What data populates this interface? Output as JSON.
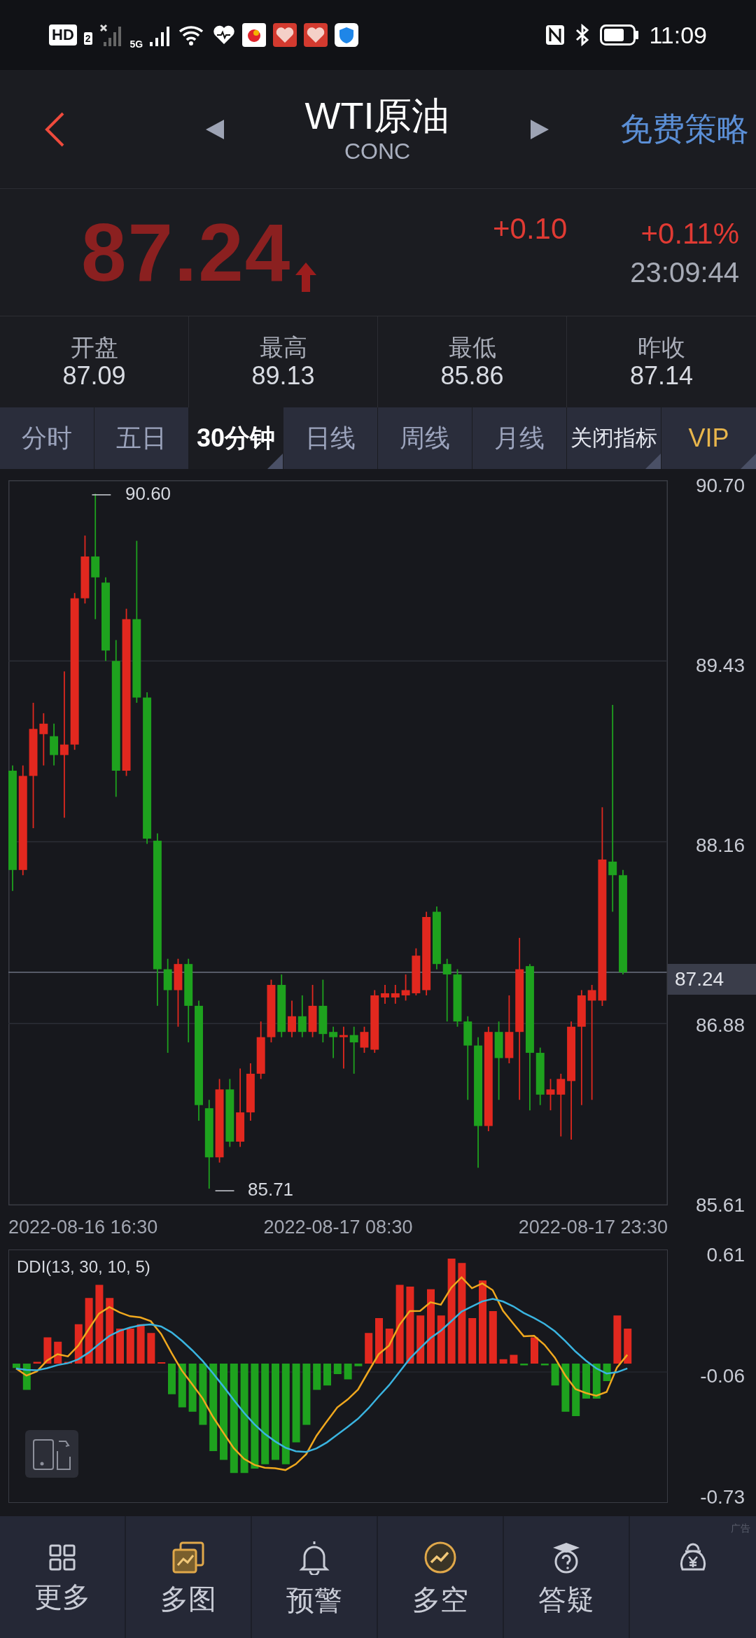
{
  "status_bar": {
    "hd_badge": "HD",
    "sim_number": "2",
    "network": "5G",
    "time": "11:09"
  },
  "header": {
    "title": "WTI原油",
    "subtitle": "CONC",
    "strategy_link": "免费策略"
  },
  "quote": {
    "price": "87.24",
    "rising": true,
    "change": "+0.10",
    "change_percent": "+0.11%",
    "time": "23:09:44"
  },
  "stats": [
    {
      "label": "开盘",
      "value": "87.09"
    },
    {
      "label": "最高",
      "value": "89.13"
    },
    {
      "label": "最低",
      "value": "85.86"
    },
    {
      "label": "昨收",
      "value": "87.14"
    }
  ],
  "tabs": [
    {
      "label": "分时",
      "selected": false,
      "has_menu": false,
      "kind": "period"
    },
    {
      "label": "五日",
      "selected": false,
      "has_menu": false,
      "kind": "period"
    },
    {
      "label": "30分钟",
      "selected": true,
      "has_menu": true,
      "kind": "period"
    },
    {
      "label": "日线",
      "selected": false,
      "has_menu": false,
      "kind": "period"
    },
    {
      "label": "周线",
      "selected": false,
      "has_menu": false,
      "kind": "period"
    },
    {
      "label": "月线",
      "selected": false,
      "has_menu": false,
      "kind": "period"
    },
    {
      "label": "关闭指标",
      "selected": false,
      "has_menu": true,
      "kind": "indicator"
    },
    {
      "label": "VIP",
      "selected": false,
      "has_menu": true,
      "kind": "vip"
    }
  ],
  "price_chart": {
    "y_ticks": [
      "90.70",
      "89.43",
      "88.16",
      "86.88",
      "85.61"
    ],
    "current_price": "87.24",
    "high_marker": "90.60",
    "low_marker": "85.71",
    "x_labels": [
      "2022-08-16 16:30",
      "2022-08-17 08:30",
      "2022-08-17 23:30"
    ]
  },
  "indicator": {
    "title": "DDI(13, 30, 10, 5)",
    "y_ticks": [
      "0.61",
      "-0.06",
      "-0.73"
    ]
  },
  "bottom_nav": [
    {
      "label": "更多"
    },
    {
      "label": "多图"
    },
    {
      "label": "预警"
    },
    {
      "label": "多空"
    },
    {
      "label": "答疑"
    },
    {
      "ad_tag": "广告"
    }
  ]
}
